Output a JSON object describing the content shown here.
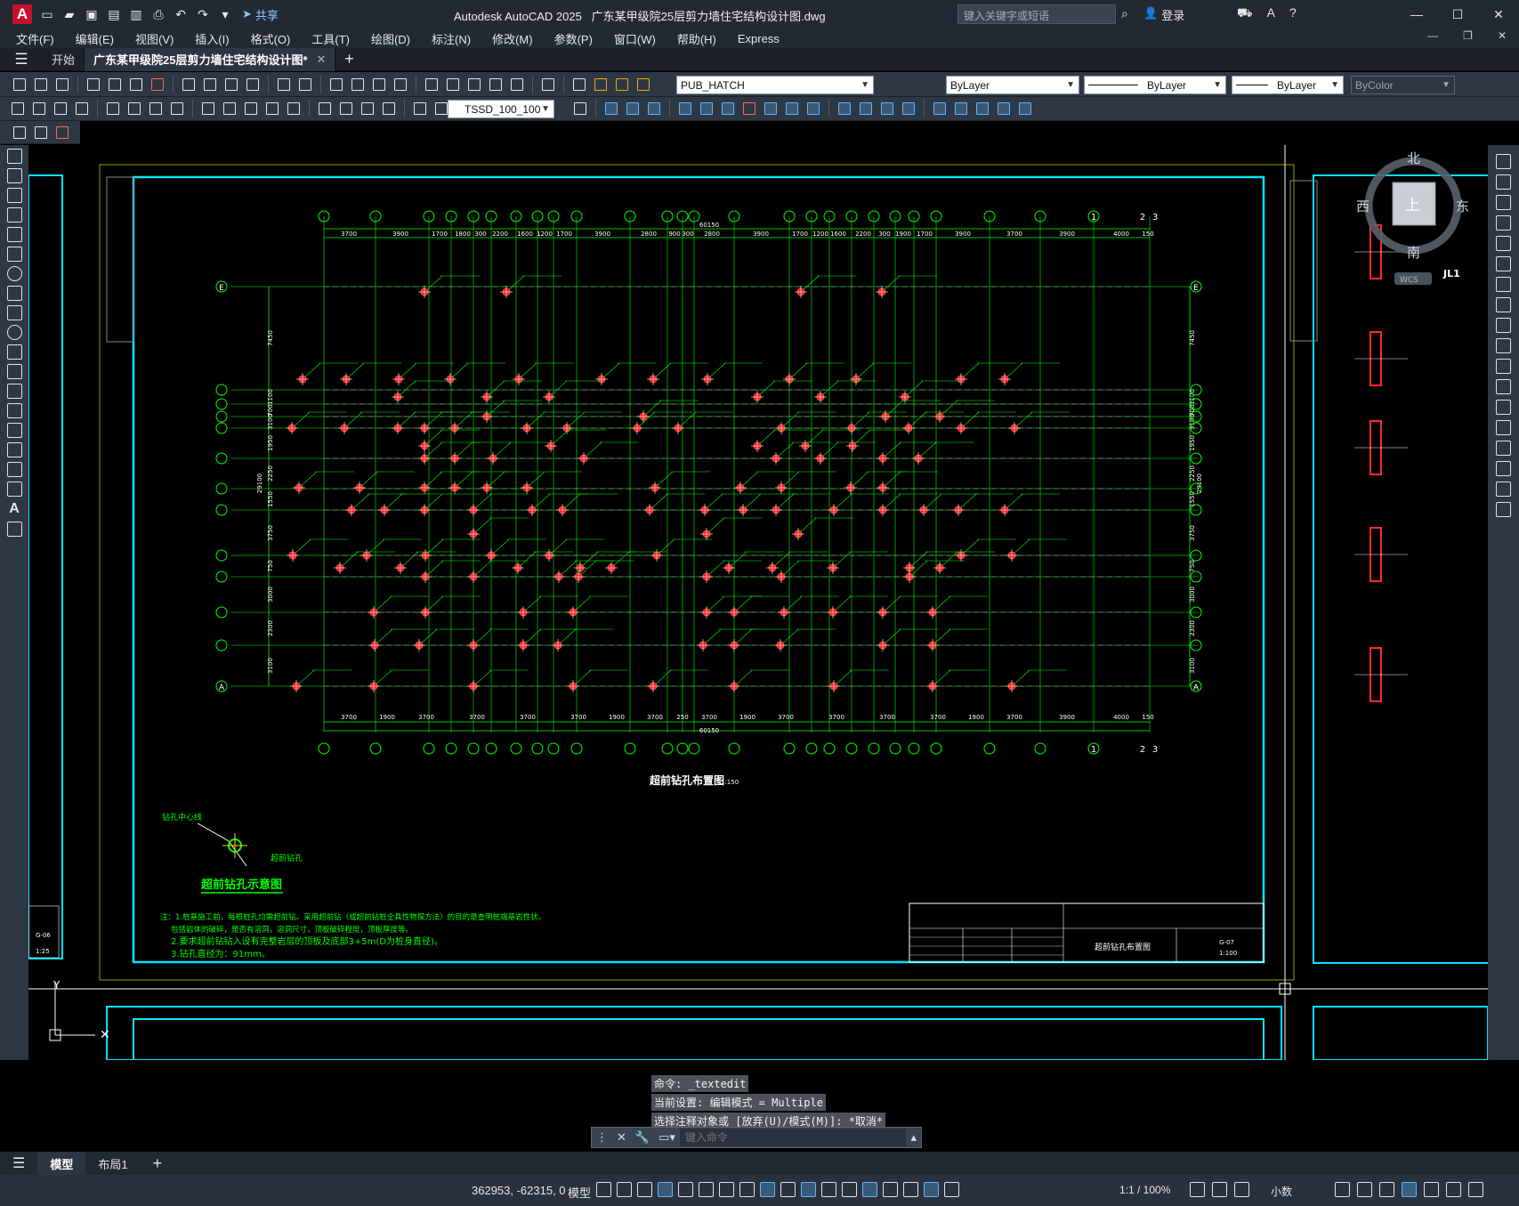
{
  "titlebar": {
    "app_name": "Autodesk AutoCAD 2025",
    "file_name": "广东某甲级院25层剪力墙住宅结构设计图.dwg",
    "share_label": "共享",
    "search_placeholder": "键入关键字或短语",
    "login_label": "登录"
  },
  "menu": [
    "文件(F)",
    "编辑(E)",
    "视图(V)",
    "插入(I)",
    "格式(O)",
    "工具(T)",
    "绘图(D)",
    "标注(N)",
    "修改(M)",
    "参数(P)",
    "窗口(W)",
    "帮助(H)",
    "Express"
  ],
  "file_tabs": {
    "start_label": "开始",
    "active_label": "广东某甲级院25层剪力墙住宅结构设计图*"
  },
  "toolbar": {
    "layer_name": "PUB_HATCH",
    "color_value": "ByLayer",
    "linetype_value": "ByLayer",
    "lineweight_value": "ByLayer",
    "plotstyle_value": "ByColor",
    "dimstyle_value": "TSSD_100_100"
  },
  "viewcube": {
    "north": "北",
    "south": "南",
    "east": "东",
    "west": "西",
    "top": "上",
    "wcs": "WCS"
  },
  "drawing": {
    "plan_title": "超前钻孔布置图",
    "plan_scale": "1:150",
    "total_dim": "60150",
    "top_dims": [
      "3700",
      "3900",
      "1700",
      "1800",
      "300",
      "2200",
      "1600",
      "1200",
      "1700",
      "3900",
      "2800",
      "900",
      "300",
      "2800",
      "3900",
      "1700",
      "1200",
      "1600",
      "2200",
      "300",
      "1900",
      "1700",
      "3900",
      "3700",
      "3900",
      "4000",
      "150"
    ],
    "bottom_dims": [
      "3700",
      "1900",
      "3700",
      "3700",
      "3700",
      "3700",
      "1900",
      "3700",
      "250",
      "3700",
      "1900",
      "3700",
      "3700",
      "3700",
      "3700",
      "1900",
      "3700",
      "3900",
      "4000",
      "150"
    ],
    "left_dims": [
      "7450",
      "1100",
      "700",
      "3100",
      "1950",
      "2250",
      "1550",
      "3750",
      "750",
      "3000",
      "2300",
      "3100"
    ],
    "left_total": "29100",
    "axis_top_labels": [
      "1",
      "2",
      "3"
    ],
    "axis_row_labels": [
      "E",
      "A"
    ],
    "legend_title": "超前钻孔示意图",
    "legend_label_center": "钻孔中心线",
    "legend_label_hole": "超前钻孔",
    "notes": [
      "注：1.桩基施工前，每根桩孔均需超前钻。采用超前钻（或超前钻桩全具性物探方法）的目的是查明桩端基岩性状，",
      "包括岩体的破碎，是否有溶洞，溶洞尺寸，顶板破碎程度，顶板厚度等。",
      "2.要求超前钻钻入设有完整岩层的顶板及底部3+5m(D为桩身直径)。",
      "3.钻孔直径为：91mm。"
    ],
    "title_block_name": "超前钻孔布置图",
    "title_block_scale": "1:100",
    "title_block_sheet": "G-07",
    "right_sheet_label": "JL1",
    "left_sheet_scale": "1:25",
    "left_sheet_num": "G-06"
  },
  "command_line": {
    "history": [
      "命令: _textedit",
      "当前设置: 编辑模式 = Multiple",
      "选择注释对象或 [放弃(U)/模式(M)]: *取消*"
    ],
    "input_placeholder": "键入命令"
  },
  "layout_tabs": [
    "模型",
    "布局1"
  ],
  "status": {
    "coords": "362953, -62315, 0",
    "model_label": "模型",
    "scale": "1:1 / 100%",
    "units": "小数"
  }
}
